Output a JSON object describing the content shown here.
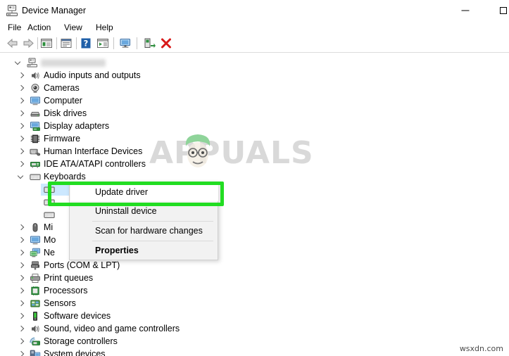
{
  "window": {
    "title": "Device Manager",
    "icon": "device-manager-icon",
    "controls": {
      "minimize": "–",
      "maximize": "□"
    }
  },
  "menubar": {
    "items": [
      {
        "label": "File"
      },
      {
        "label": "Action"
      },
      {
        "label": "View"
      },
      {
        "label": "Help"
      }
    ]
  },
  "toolbar": {
    "buttons": [
      {
        "name": "back-icon",
        "title": "Back"
      },
      {
        "name": "forward-icon",
        "title": "Forward"
      },
      {
        "name": "show-hide-console-tree-icon",
        "title": "Show/Hide console tree"
      },
      {
        "name": "properties-icon",
        "title": "Properties"
      },
      {
        "name": "help-icon",
        "title": "Help"
      },
      {
        "name": "view-icon",
        "title": "View"
      },
      {
        "name": "scan-hardware-changes-icon",
        "title": "Scan for hardware changes"
      },
      {
        "name": "update-driver-icon",
        "title": "Update driver"
      },
      {
        "name": "uninstall-device-icon",
        "title": "Uninstall device"
      }
    ]
  },
  "tree": {
    "root": {
      "label": "",
      "redacted": true,
      "expanded": true,
      "icon": "computer-node-icon"
    },
    "items": [
      {
        "label": "Audio inputs and outputs",
        "icon": "speaker-icon",
        "expanded": false,
        "indent": 1
      },
      {
        "label": "Cameras",
        "icon": "camera-icon",
        "expanded": false,
        "indent": 1
      },
      {
        "label": "Computer",
        "icon": "monitor-icon",
        "expanded": false,
        "indent": 1
      },
      {
        "label": "Disk drives",
        "icon": "disk-drive-icon",
        "expanded": false,
        "indent": 1
      },
      {
        "label": "Display adapters",
        "icon": "display-adapter-icon",
        "expanded": false,
        "indent": 1
      },
      {
        "label": "Firmware",
        "icon": "firmware-chip-icon",
        "expanded": false,
        "indent": 1
      },
      {
        "label": "Human Interface Devices",
        "icon": "hid-icon",
        "expanded": false,
        "indent": 1
      },
      {
        "label": "IDE ATA/ATAPI controllers",
        "icon": "ide-controller-icon",
        "expanded": false,
        "indent": 1
      },
      {
        "label": "Keyboards",
        "icon": "keyboard-icon",
        "expanded": true,
        "indent": 1
      },
      {
        "label": "",
        "icon": "keyboard-icon",
        "indent": 2,
        "selected": true,
        "obscured": true
      },
      {
        "label": "",
        "icon": "keyboard-icon",
        "indent": 2,
        "obscured": true
      },
      {
        "label": "",
        "icon": "keyboard-icon",
        "indent": 2,
        "obscured": true
      },
      {
        "label": "Mi",
        "icon": "mouse-icon",
        "expanded": false,
        "indent": 1,
        "truncated": true
      },
      {
        "label": "Mo",
        "icon": "monitor-icon",
        "expanded": false,
        "indent": 1,
        "truncated": true
      },
      {
        "label": "Ne",
        "icon": "network-adapter-icon",
        "expanded": false,
        "indent": 1,
        "truncated": true
      },
      {
        "label": "Ports (COM & LPT)",
        "icon": "port-icon",
        "expanded": false,
        "indent": 1
      },
      {
        "label": "Print queues",
        "icon": "printer-icon",
        "expanded": false,
        "indent": 1
      },
      {
        "label": "Processors",
        "icon": "processor-icon",
        "expanded": false,
        "indent": 1
      },
      {
        "label": "Sensors",
        "icon": "sensor-icon",
        "expanded": false,
        "indent": 1
      },
      {
        "label": "Software devices",
        "icon": "software-device-icon",
        "expanded": false,
        "indent": 1
      },
      {
        "label": "Sound, video and game controllers",
        "icon": "speaker-icon",
        "expanded": false,
        "indent": 1
      },
      {
        "label": "Storage controllers",
        "icon": "storage-controller-icon",
        "expanded": false,
        "indent": 1
      },
      {
        "label": "System devices",
        "icon": "system-device-icon",
        "expanded": false,
        "indent": 1
      }
    ]
  },
  "context_menu": {
    "items": [
      {
        "label": "Update driver",
        "highlighted": true,
        "bold": false
      },
      {
        "label": "Uninstall device",
        "highlighted": false,
        "bold": false
      },
      {
        "label": "Scan for hardware changes",
        "highlighted": false,
        "bold": false
      },
      {
        "label": "Properties",
        "highlighted": false,
        "bold": true
      }
    ]
  },
  "annotation": {
    "highlight_color": "#22dd22",
    "target_label": "Update driver"
  },
  "watermarks": {
    "brand": "APPUALS",
    "site": "wsxdn.com"
  },
  "colors": {
    "selection": "#cce8ff",
    "menu_bg": "#f2f2f2",
    "highlight_green": "#22dd22"
  }
}
